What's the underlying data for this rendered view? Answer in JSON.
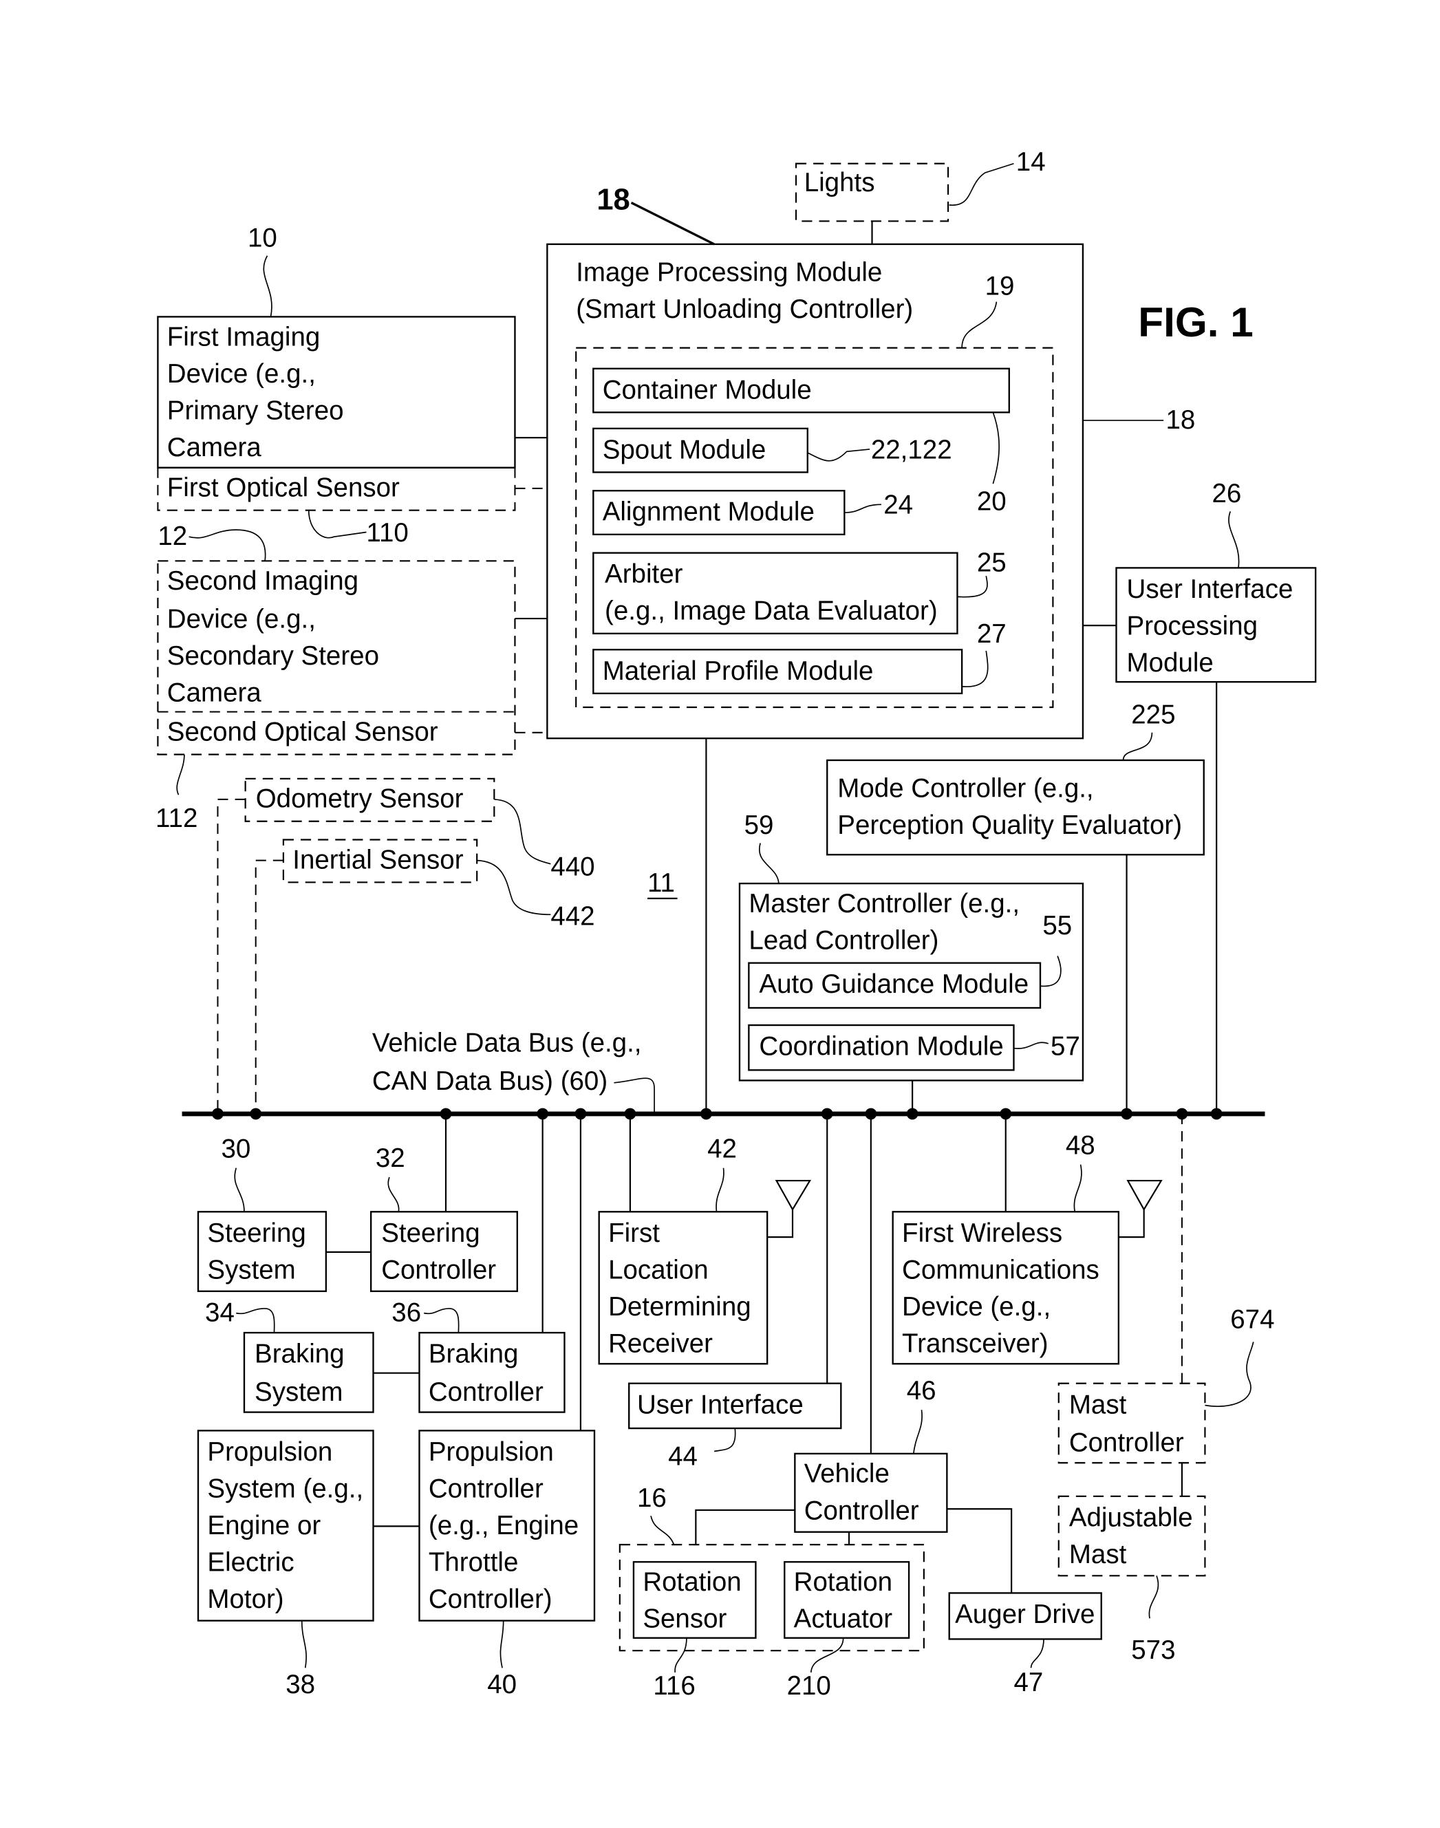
{
  "figure": {
    "title": "FIG. 1",
    "system_ref": "11"
  },
  "blocks": {
    "lights": {
      "label": [
        "Lights"
      ],
      "ref": "14"
    },
    "image_processing": {
      "label": [
        "Image Processing Module",
        "(Smart Unloading Controller)"
      ],
      "ref": "18",
      "ref_arrow": "18",
      "inner_ref": "19"
    },
    "container_module": {
      "label": [
        "Container Module"
      ],
      "ref": "20"
    },
    "spout_module": {
      "label": [
        "Spout Module"
      ],
      "ref": "22,122"
    },
    "alignment_module": {
      "label": [
        "Alignment Module"
      ],
      "ref": "24"
    },
    "arbiter": {
      "label": [
        "Arbiter",
        "(e.g., Image Data Evaluator)"
      ],
      "ref": "25"
    },
    "material_profile": {
      "label": [
        "Material Profile Module"
      ],
      "ref": "27"
    },
    "first_imaging": {
      "label": [
        "First Imaging",
        "Device (e.g.,",
        "Primary Stereo",
        "Camera"
      ],
      "ref": "10"
    },
    "first_optical": {
      "label": [
        "First Optical Sensor"
      ],
      "ref": "110"
    },
    "second_imaging": {
      "label": [
        "Second Imaging",
        "Device (e.g.,",
        "Secondary Stereo",
        "Camera"
      ],
      "ref": "12"
    },
    "second_optical": {
      "label": [
        "Second Optical Sensor"
      ],
      "ref": "112"
    },
    "odometry": {
      "label": [
        "Odometry Sensor"
      ],
      "ref": "440"
    },
    "inertial": {
      "label": [
        "Inertial Sensor"
      ],
      "ref": "442"
    },
    "ui_processing": {
      "label": [
        "User Interface",
        "Processing",
        "Module"
      ],
      "ref": "26"
    },
    "mode_controller": {
      "label": [
        "Mode Controller (e.g.,",
        "Perception Quality Evaluator)"
      ],
      "ref": "225"
    },
    "master_controller": {
      "label": [
        "Master Controller (e.g.,",
        "Lead Controller)"
      ],
      "ref": "59"
    },
    "auto_guidance": {
      "label": [
        "Auto Guidance Module"
      ],
      "ref": "55"
    },
    "coordination": {
      "label": [
        "Coordination Module"
      ],
      "ref": "57"
    },
    "data_bus": {
      "label": [
        "Vehicle Data Bus (e.g.,",
        "CAN Data Bus) (60)"
      ]
    },
    "steering_system": {
      "label": [
        "Steering",
        "System"
      ],
      "ref": "30"
    },
    "steering_controller": {
      "label": [
        "Steering",
        "Controller"
      ],
      "ref": "32"
    },
    "braking_system": {
      "label": [
        "Braking",
        "System"
      ],
      "ref": "34"
    },
    "braking_controller": {
      "label": [
        "Braking",
        "Controller"
      ],
      "ref": "36"
    },
    "propulsion_system": {
      "label": [
        "Propulsion",
        "System (e.g.,",
        "Engine or",
        "Electric",
        "Motor)"
      ],
      "ref": "38"
    },
    "propulsion_controller": {
      "label": [
        "Propulsion",
        "Controller",
        "(e.g., Engine",
        "Throttle",
        "Controller)"
      ],
      "ref": "40"
    },
    "location_receiver": {
      "label": [
        "First",
        "Location",
        "Determining",
        "Receiver"
      ],
      "ref": "42"
    },
    "user_interface": {
      "label": [
        "User Interface"
      ],
      "ref": "44"
    },
    "wireless_device": {
      "label": [
        "First Wireless",
        "Communications",
        "Device (e.g.,",
        "Transceiver)"
      ],
      "ref": "48"
    },
    "vehicle_controller": {
      "label": [
        "Vehicle",
        "Controller"
      ],
      "ref": "46"
    },
    "rotation_group": {
      "ref": "16"
    },
    "rotation_sensor": {
      "label": [
        "Rotation",
        "Sensor"
      ],
      "ref": "116"
    },
    "rotation_actuator": {
      "label": [
        "Rotation",
        "Actuator"
      ],
      "ref": "210"
    },
    "auger_drive": {
      "label": [
        "Auger Drive"
      ],
      "ref": "47"
    },
    "mast_controller": {
      "label": [
        "Mast",
        "Controller"
      ],
      "ref": "674"
    },
    "adjustable_mast": {
      "label": [
        "Adjustable",
        "Mast"
      ],
      "ref": "573"
    }
  }
}
